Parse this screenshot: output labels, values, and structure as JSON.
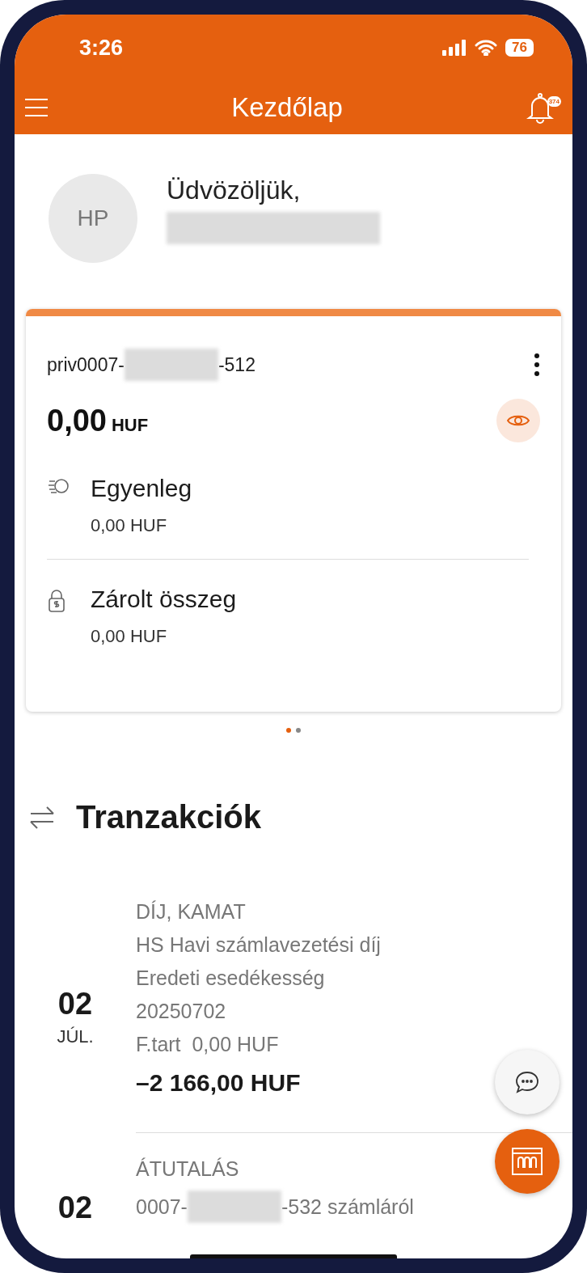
{
  "status_bar": {
    "time": "3:26",
    "battery": "76"
  },
  "header": {
    "title": "Kezdőlap",
    "notification_count": "374"
  },
  "profile": {
    "initials": "HP",
    "greeting": "Üdvözöljük,"
  },
  "account_card": {
    "number_prefix": "priv0007-",
    "number_suffix": "-512",
    "amount": "0,00",
    "currency": "HUF",
    "rows": [
      {
        "kind": "balance",
        "label": "Egyenleg",
        "value": "0,00 HUF"
      },
      {
        "kind": "locked",
        "label": "Zárolt összeg",
        "value": "0,00 HUF"
      }
    ]
  },
  "pager": [
    {
      "selected": true
    },
    {
      "selected": false
    }
  ],
  "transactions": {
    "title": "Tranzakciók",
    "items": [
      {
        "day": "02",
        "month": "JÚL.",
        "lines": [
          "DÍJ, KAMAT",
          "HS Havi számlavezetési díj",
          "Eredeti esedékesség",
          "20250702",
          "F.tart  0,00 HUF"
        ],
        "amount": "–2 166,00 HUF"
      },
      {
        "day": "02",
        "lines": [
          "ÁTUTALÁS"
        ],
        "masked_line": {
          "prefix": "0007-",
          "suffix": "-532 számláról"
        }
      }
    ]
  }
}
